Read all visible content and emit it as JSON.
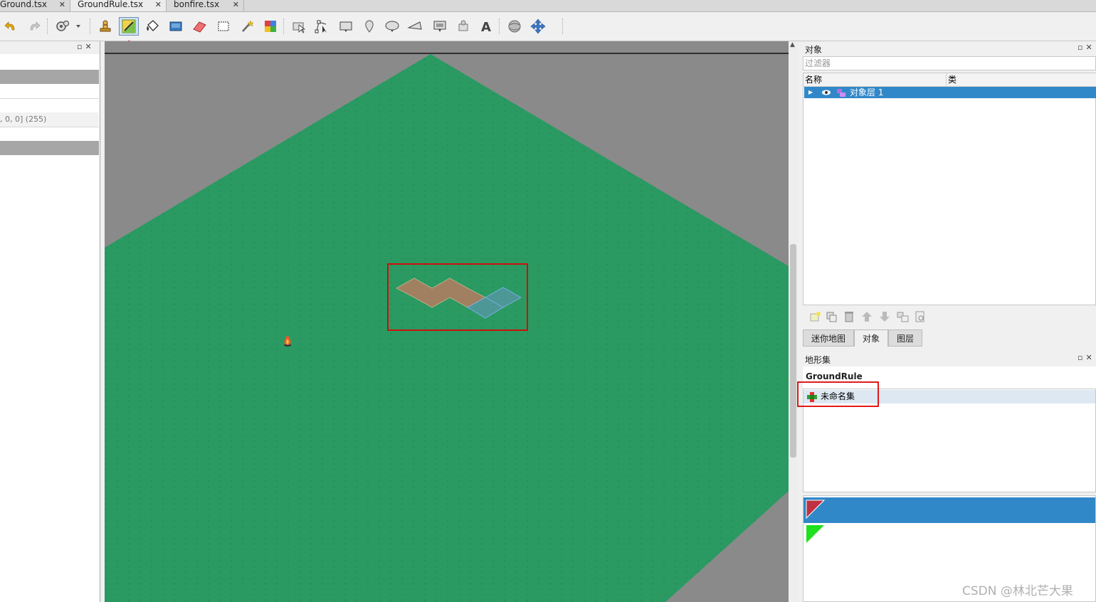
{
  "tabs": [
    {
      "label": "Ground.tsx",
      "close": "✕"
    },
    {
      "label": "GroundRule.tsx",
      "close": "✕"
    },
    {
      "label": "bonfire.tsx",
      "close": "✕"
    }
  ],
  "toolbar": {
    "icons": [
      "undo-icon",
      "redo-icon",
      "command-icon",
      "stamp-brush-icon",
      "terrain-brush-icon",
      "bucket-fill-icon",
      "shape-fill-icon",
      "eraser-icon",
      "rectangular-select-icon",
      "magic-wand-icon",
      "select-same-tile-icon",
      "select-objects-icon",
      "edit-polygons-icon",
      "insert-rectangle-icon",
      "insert-point-icon",
      "insert-ellipse-icon",
      "insert-polygon-icon",
      "insert-tile-icon",
      "insert-template-icon",
      "insert-text-icon",
      "world-tool-icon",
      "move-icon"
    ],
    "checked": "terrain-brush-icon"
  },
  "left_panel": {
    "property_value": ", 0, 0] (255)"
  },
  "objects_panel": {
    "title": "对象",
    "filter_placeholder": "过滤器",
    "col_name": "名称",
    "col_class": "类",
    "layer_name": "对象层 1"
  },
  "dock_tabs": [
    {
      "label": "迷你地图",
      "active": false
    },
    {
      "label": "对象",
      "active": true
    },
    {
      "label": "图层",
      "active": false
    }
  ],
  "terrain_panel": {
    "title": "地形集",
    "tileset_name": "GroundRule",
    "terrain_set": "未命名集"
  },
  "watermark": "CSDN @林北芒大果",
  "colors": {
    "map_green": "#2a9a62",
    "selection_blue": "#3188c8",
    "annotation_red": "#e00000"
  }
}
